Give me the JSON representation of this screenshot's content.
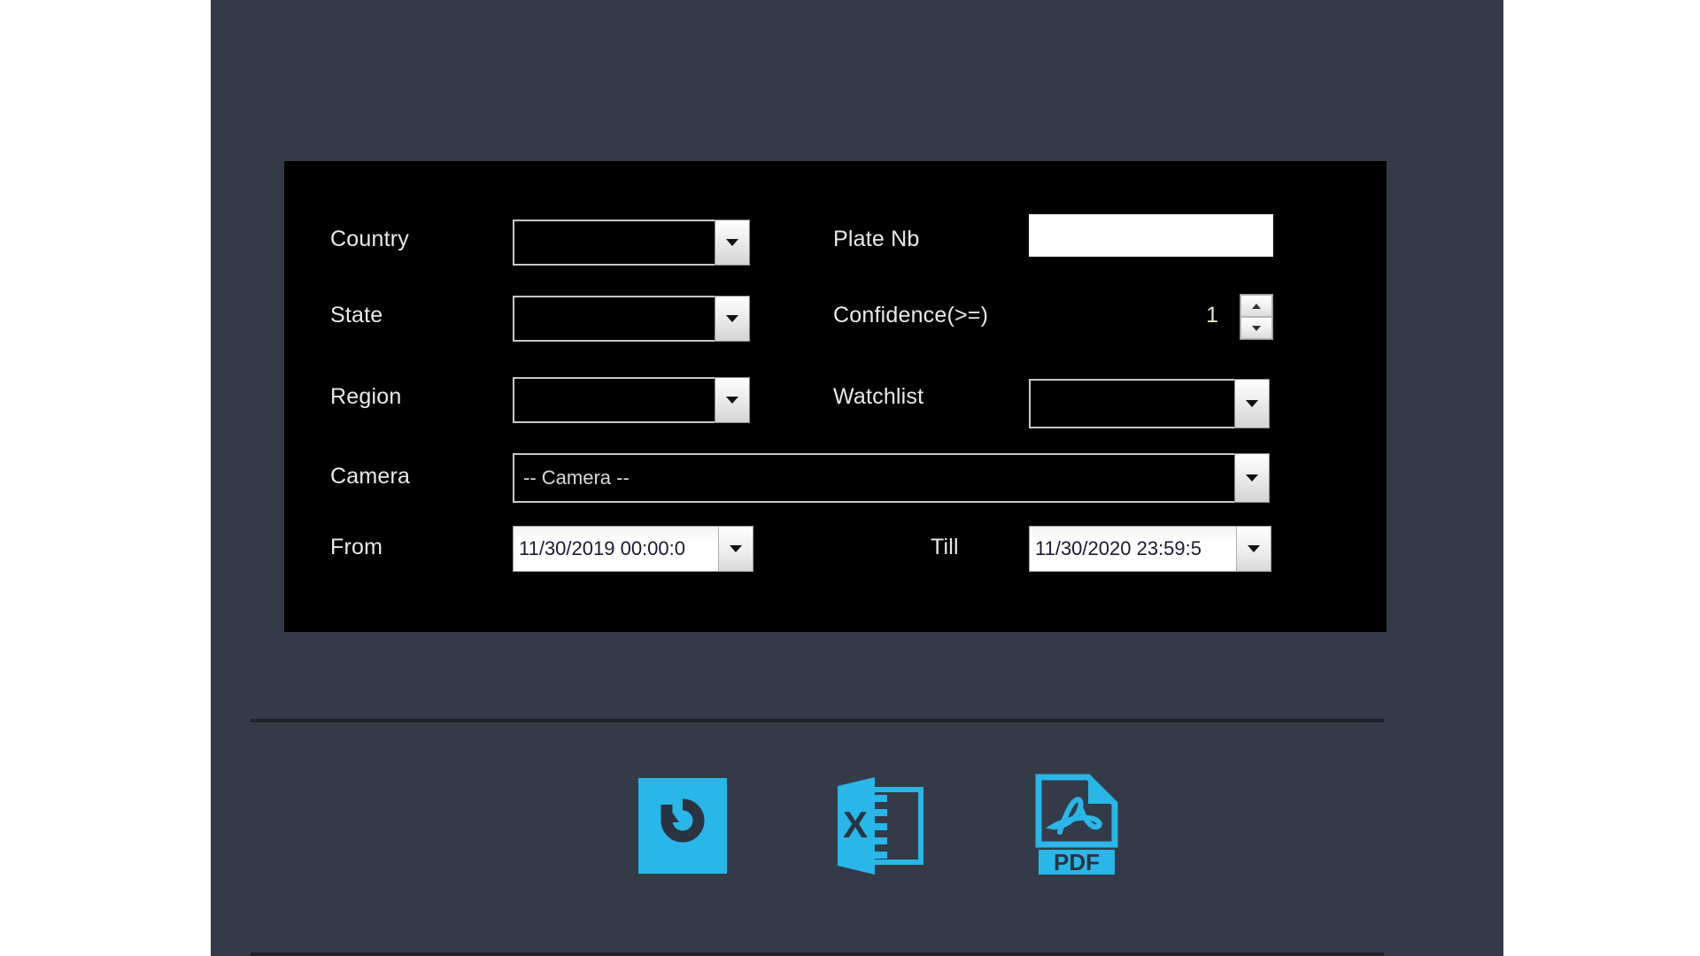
{
  "theme": {
    "page_background": "#ffffff",
    "panel_background": "#343b47",
    "filter_panel_background": "#000000",
    "accent": "#29b6e8",
    "label_color": "#e9eaec",
    "divider_color": "#1d222b"
  },
  "filters": {
    "country": {
      "label": "Country",
      "value": "",
      "control": "dropdown"
    },
    "state": {
      "label": "State",
      "value": "",
      "control": "dropdown"
    },
    "region": {
      "label": "Region",
      "value": "",
      "control": "dropdown"
    },
    "camera": {
      "label": "Camera",
      "value": "-- Camera --",
      "control": "dropdown"
    },
    "plate_nb": {
      "label": "Plate Nb",
      "value": "",
      "placeholder": "",
      "control": "text"
    },
    "confidence": {
      "label": "Confidence(>=)",
      "value": "1",
      "control": "spinner"
    },
    "watchlist": {
      "label": "Watchlist",
      "value": "",
      "control": "dropdown"
    },
    "from": {
      "label": "From",
      "value": "11/30/2019 00:00:0",
      "control": "datetime"
    },
    "till": {
      "label": "Till",
      "value": "11/30/2020 23:59:5",
      "control": "datetime"
    }
  },
  "actions": [
    {
      "name": "refresh-button",
      "icon": "refresh-icon",
      "label": ""
    },
    {
      "name": "export-excel-button",
      "icon": "excel-icon",
      "label": "X"
    },
    {
      "name": "export-pdf-button",
      "icon": "pdf-icon",
      "label": "PDF"
    }
  ]
}
